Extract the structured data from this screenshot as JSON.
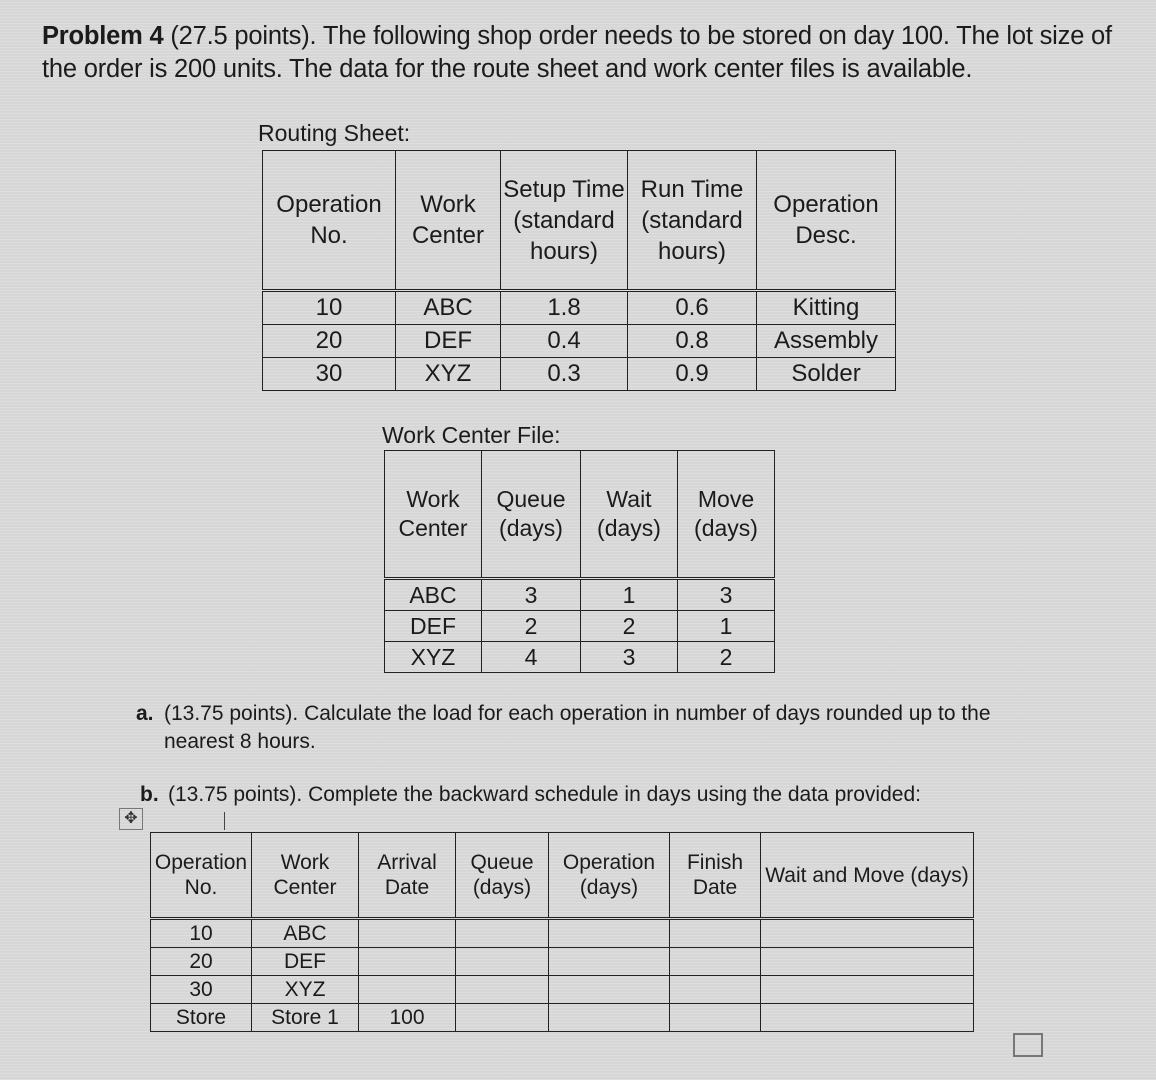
{
  "problem": {
    "label": "Problem 4",
    "text": " (27.5 points). The following shop order needs to be stored on day 100. The lot size of the order is 200 units. The data for the route sheet and work center files is available."
  },
  "routing_sheet": {
    "caption": "Routing Sheet:",
    "headers": [
      "Operation No.",
      "Work Center",
      "Setup Time (standard hours)",
      "Run Time (standard hours)",
      "Operation Desc."
    ],
    "rows": [
      [
        "10",
        "ABC",
        "1.8",
        "0.6",
        "Kitting"
      ],
      [
        "20",
        "DEF",
        "0.4",
        "0.8",
        "Assembly"
      ],
      [
        "30",
        "XYZ",
        "0.3",
        "0.9",
        "Solder"
      ]
    ]
  },
  "work_center_file": {
    "caption": "Work Center File:",
    "headers": [
      "Work Center",
      "Queue (days)",
      "Wait (days)",
      "Move (days)"
    ],
    "rows": [
      [
        "ABC",
        "3",
        "1",
        "3"
      ],
      [
        "DEF",
        "2",
        "2",
        "1"
      ],
      [
        "XYZ",
        "4",
        "3",
        "2"
      ]
    ]
  },
  "questions": {
    "a_label": "a.",
    "a_text": "(13.75 points). Calculate the load for each operation in number of days rounded up to the nearest 8 hours.",
    "b_label": "b.",
    "b_text": "(13.75 points). Complete the backward schedule in days using the data provided:"
  },
  "schedule": {
    "headers": [
      "Operation No.",
      "Work Center",
      "Arrival Date",
      "Queue (days)",
      "Operation (days)",
      "Finish Date",
      "Wait and Move (days)"
    ],
    "rows": [
      [
        "10",
        "ABC",
        "",
        "",
        "",
        "",
        ""
      ],
      [
        "20",
        "DEF",
        "",
        "",
        "",
        "",
        ""
      ],
      [
        "30",
        "XYZ",
        "",
        "",
        "",
        "",
        ""
      ],
      [
        "Store",
        "Store 1",
        "100",
        "",
        "",
        "",
        ""
      ]
    ]
  },
  "icons": {
    "move_handle": "✥"
  }
}
